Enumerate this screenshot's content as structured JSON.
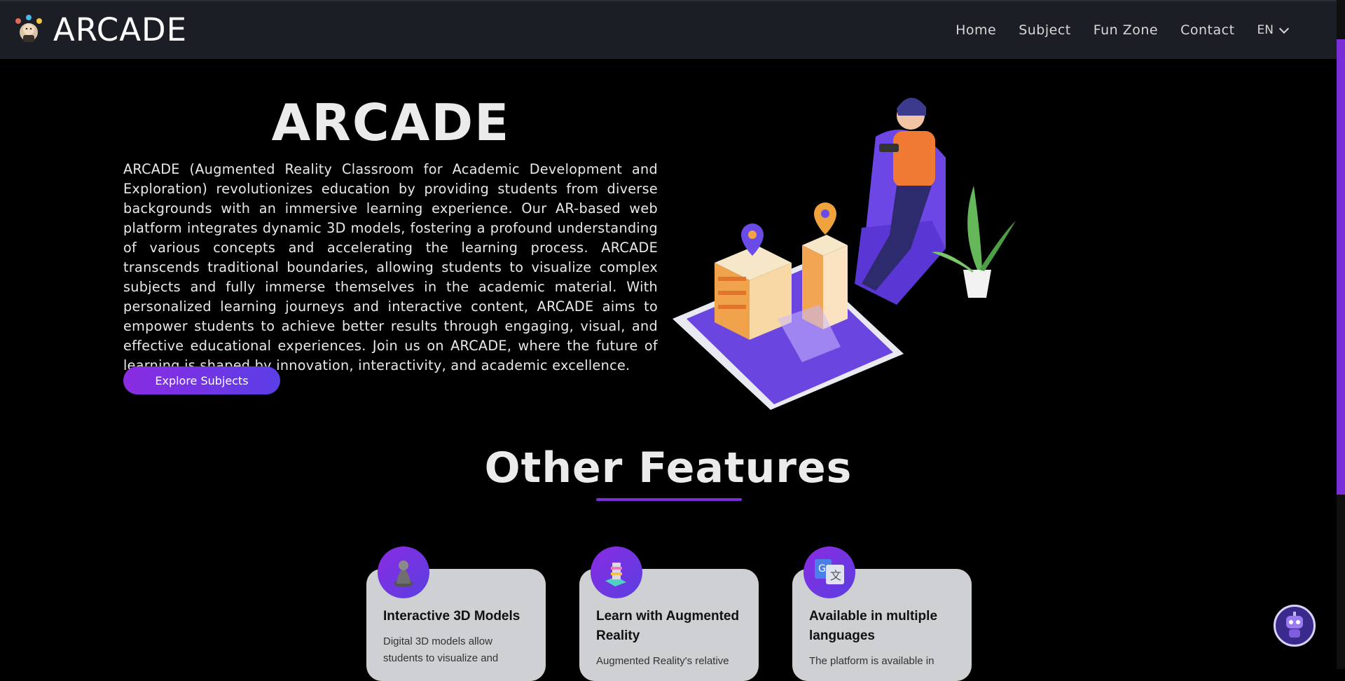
{
  "navbar": {
    "brand": "ARCADE",
    "links": [
      "Home",
      "Subject",
      "Fun Zone",
      "Contact"
    ],
    "language": "EN"
  },
  "hero": {
    "title": "ARCADE",
    "description": "ARCADE (Augmented Reality Classroom for Academic Development and Exploration) revolutionizes education by providing students from diverse backgrounds with an immersive learning experience. Our AR-based web platform integrates dynamic 3D models, fostering a profound understanding of various concepts and accelerating the learning process. ARCADE transcends traditional boundaries, allowing students to visualize complex subjects and fully immerse themselves in the academic material. With personalized learning journeys and interactive content, ARCADE aims to empower students to achieve better results through engaging, visual, and effective educational experiences. Join us on ARCADE, where the future of learning is shaped by innovation, interactivity, and academic excellence.",
    "button": "Explore Subjects"
  },
  "features": {
    "title": "Other Features",
    "cards": [
      {
        "title": "Interactive 3D Models",
        "text": "Digital 3D models allow students to visualize and",
        "icon": "3d-model-icon"
      },
      {
        "title": "Learn with Augmented Reality",
        "text": "Augmented Reality's relative",
        "icon": "augmented-reality-icon"
      },
      {
        "title": "Available in multiple languages",
        "text": "The platform is available in",
        "icon": "translate-icon"
      }
    ]
  },
  "colors": {
    "accent": "#7a2fd6",
    "navbar": "#1b1e24",
    "card": "#cfd0d3"
  }
}
